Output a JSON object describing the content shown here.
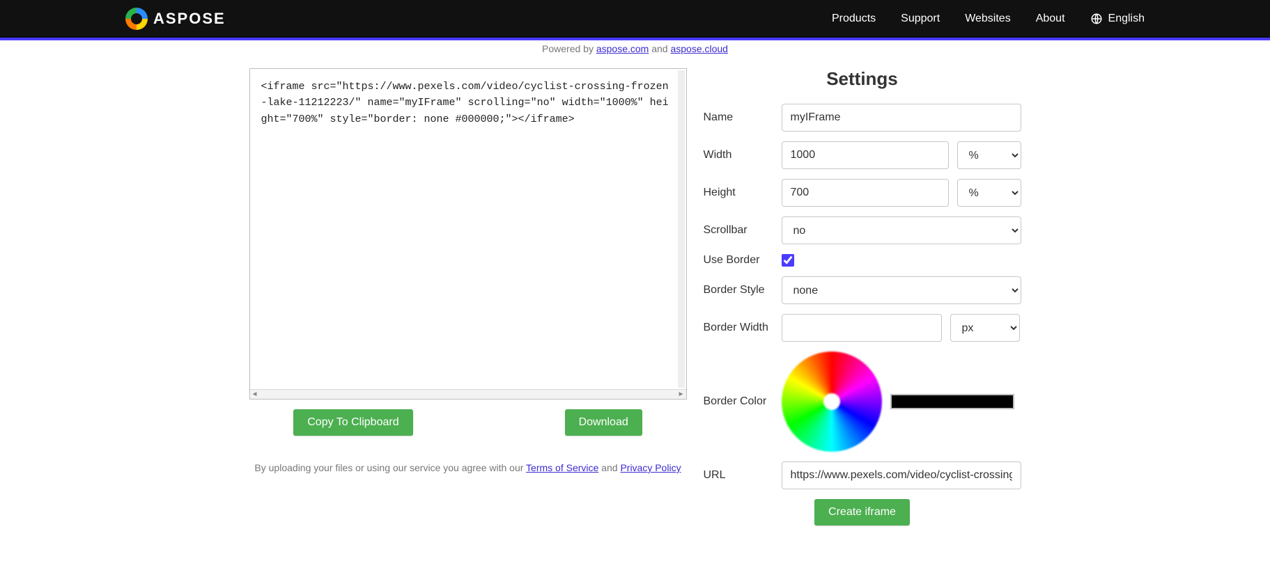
{
  "header": {
    "brand": "ASPOSE",
    "nav": {
      "products": "Products",
      "support": "Support",
      "websites": "Websites",
      "about": "About"
    },
    "language": "English"
  },
  "powered": {
    "prefix": "Powered by ",
    "link1": "aspose.com",
    "and": " and ",
    "link2": "aspose.cloud"
  },
  "code": {
    "value": "<iframe src=\"https://www.pexels.com/video/cyclist-crossing-frozen-lake-11212223/\" name=\"myIFrame\" scrolling=\"no\" width=\"1000%\" height=\"700%\" style=\"border: none #000000;\"></iframe>"
  },
  "buttons": {
    "copy": "Copy To Clipboard",
    "download": "Download"
  },
  "agree": {
    "prefix": "By uploading your files or using our service you agree with our ",
    "tos": "Terms of Service",
    "and": " and ",
    "pp": "Privacy Policy"
  },
  "settings": {
    "title": "Settings",
    "labels": {
      "name": "Name",
      "width": "Width",
      "height": "Height",
      "scrollbar": "Scrollbar",
      "useBorder": "Use Border",
      "borderStyle": "Border Style",
      "borderWidth": "Border Width",
      "borderColor": "Border Color",
      "url": "URL",
      "create": "Create iframe"
    },
    "values": {
      "name": "myIFrame",
      "width": "1000",
      "widthUnit": "%",
      "height": "700",
      "heightUnit": "%",
      "scrollbar": "no",
      "useBorder": true,
      "borderStyle": "none",
      "borderWidth": "",
      "borderWidthUnit": "px",
      "borderColorHex": "#000000",
      "url": "https://www.pexels.com/video/cyclist-crossing"
    }
  }
}
